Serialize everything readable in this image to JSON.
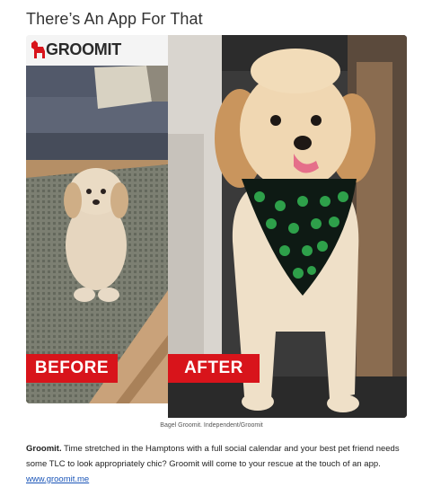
{
  "article": {
    "title": "There’s An App For That",
    "logo_text": "GROOMIT",
    "label_before": "BEFORE",
    "label_after": "AFTER",
    "caption": "Bagel Groomit. Independent/Groomit",
    "body_bold": "Groomit.",
    "body_text": " Time stretched in the Hamptons with a full social calendar and your best pet friend needs some TLC to look appropriately chic? Groomit will come to your rescue at the touch of an app. ",
    "link_text": "www.groomit.me"
  },
  "colors": {
    "label_red": "#d8141b",
    "link_blue": "#1a55b8"
  }
}
